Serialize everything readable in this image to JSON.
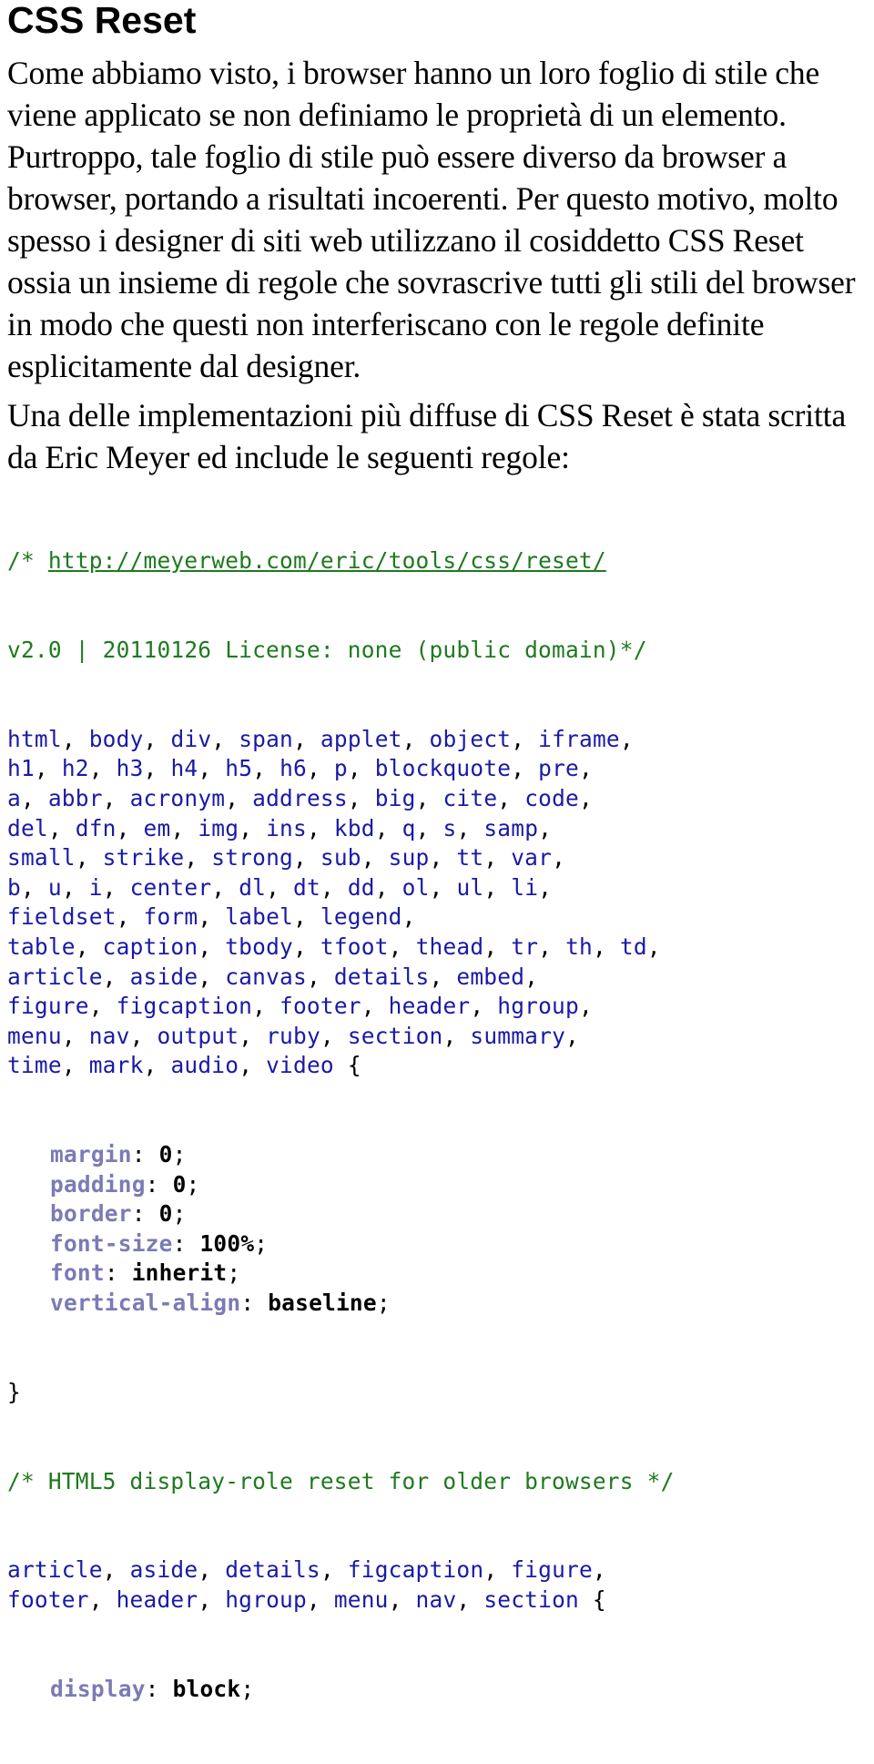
{
  "title": "CSS Reset",
  "paragraphs": [
    "Come abbiamo visto, i browser hanno un loro foglio di stile che viene applicato se non definiamo le proprietà di un elemento. Purtroppo, tale foglio di stile può essere diverso da browser a browser, portando a risultati incoerenti. Per questo motivo, molto spesso i designer di siti web utilizzano il cosiddetto CSS Reset ossia un insieme di regole che sovrascrive tutti gli stili del browser in modo che questi non interferiscano con le regole definite esplicitamente dal designer.",
    "Una delle implementazioni più diffuse di CSS Reset è stata scritta da Eric Meyer ed include le seguenti regole:"
  ],
  "colors": {
    "comment": "#1e7a1e",
    "selector": "#1a1aa6",
    "property": "#7b7bb6",
    "value": "#000000"
  },
  "code": {
    "comment1_prefix": "/* ",
    "comment1_link": "http://meyerweb.com/eric/tools/css/reset/",
    "comment1_line2": "v2.0 | 20110126 License: none (public domain)*/",
    "selector_lines_1": [
      [
        "html",
        "body",
        "div",
        "span",
        "applet",
        "object",
        "iframe"
      ],
      [
        "h1",
        "h2",
        "h3",
        "h4",
        "h5",
        "h6",
        "p",
        "blockquote",
        "pre"
      ],
      [
        "a",
        "abbr",
        "acronym",
        "address",
        "big",
        "cite",
        "code"
      ],
      [
        "del",
        "dfn",
        "em",
        "img",
        "ins",
        "kbd",
        "q",
        "s",
        "samp"
      ],
      [
        "small",
        "strike",
        "strong",
        "sub",
        "sup",
        "tt",
        "var"
      ],
      [
        "b",
        "u",
        "i",
        "center",
        "dl",
        "dt",
        "dd",
        "ol",
        "ul",
        "li"
      ],
      [
        "fieldset",
        "form",
        "label",
        "legend"
      ],
      [
        "table",
        "caption",
        "tbody",
        "tfoot",
        "thead",
        "tr",
        "th",
        "td"
      ],
      [
        "article",
        "aside",
        "canvas",
        "details",
        "embed"
      ],
      [
        "figure",
        "figcaption",
        "footer",
        "header",
        "hgroup"
      ],
      [
        "menu",
        "nav",
        "output",
        "ruby",
        "section",
        "summary"
      ],
      [
        "time",
        "mark",
        "audio",
        "video"
      ]
    ],
    "declarations_1": [
      {
        "prop": "margin",
        "val": "0"
      },
      {
        "prop": "padding",
        "val": "0"
      },
      {
        "prop": "border",
        "val": "0"
      },
      {
        "prop": "font-size",
        "val": "100%"
      },
      {
        "prop": "font",
        "val": "inherit"
      },
      {
        "prop": "vertical-align",
        "val": "baseline"
      }
    ],
    "comment2": "/* HTML5 display-role reset for older browsers */",
    "selector_lines_2": [
      [
        "article",
        "aside",
        "details",
        "figcaption",
        "figure"
      ],
      [
        "footer",
        "header",
        "hgroup",
        "menu",
        "nav",
        "section"
      ]
    ],
    "declarations_2": [
      {
        "prop": "display",
        "val": "block"
      }
    ]
  }
}
